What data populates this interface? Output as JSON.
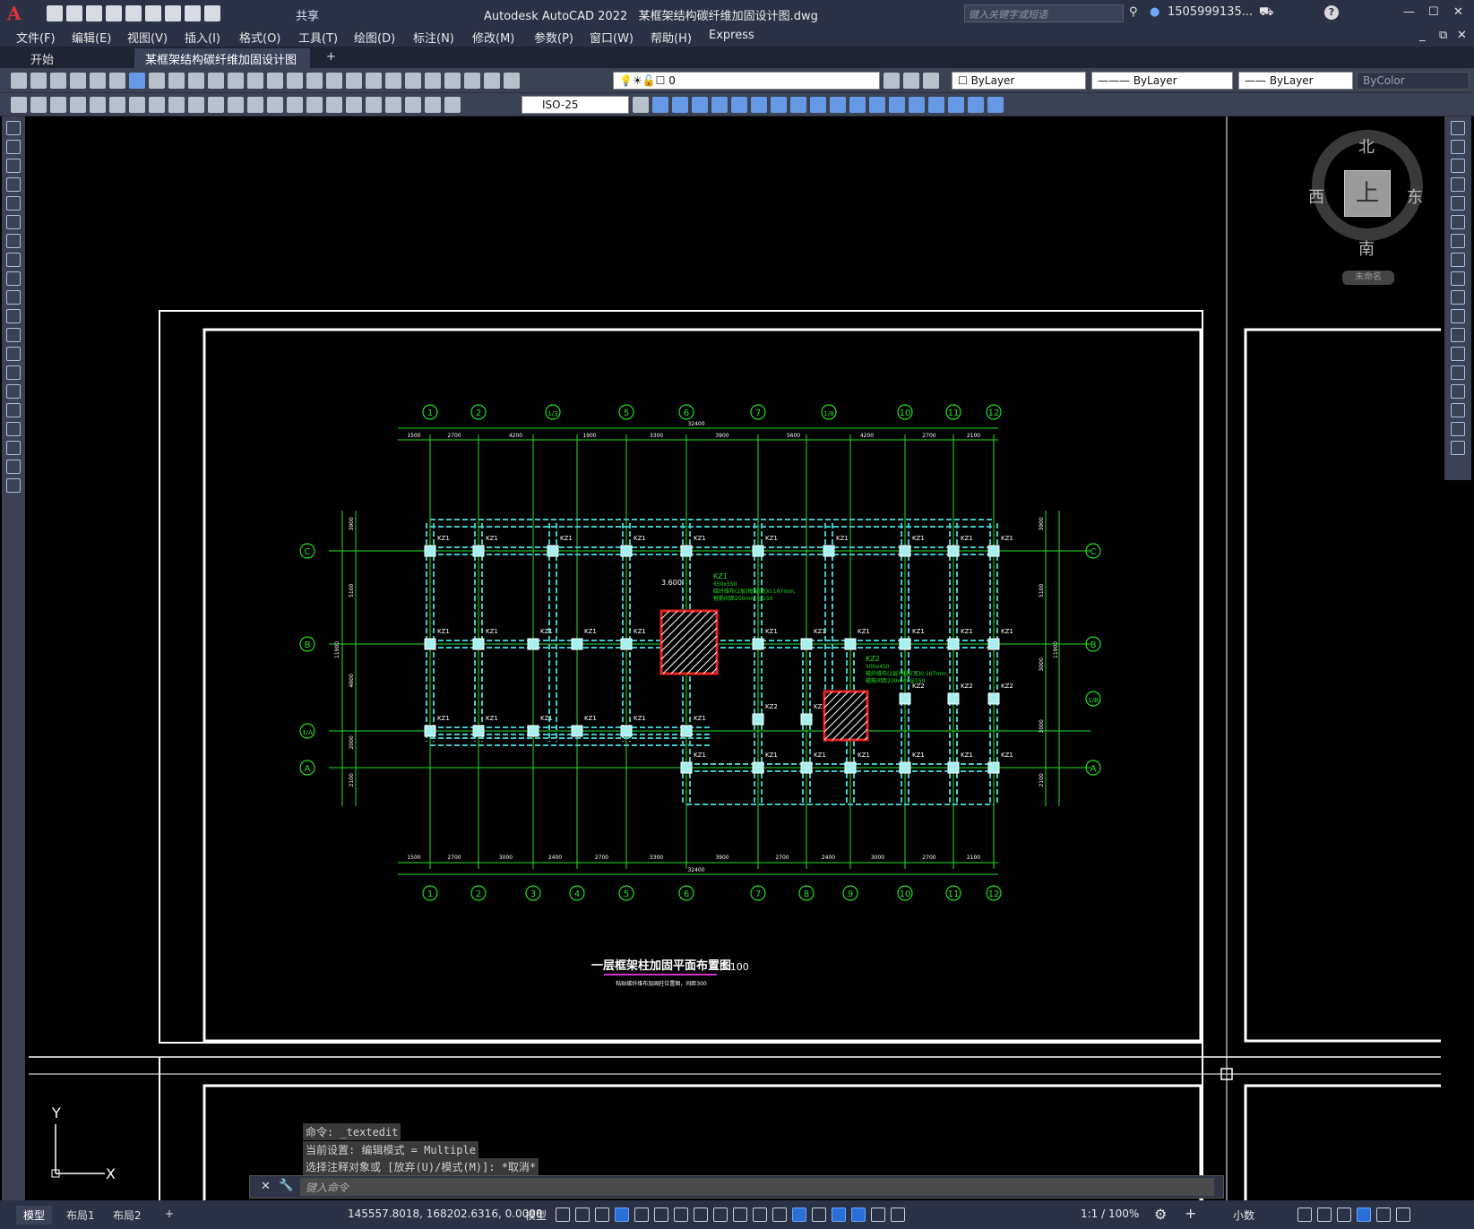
{
  "app": {
    "title": "Autodesk AutoCAD 2022",
    "filename": "某框架结构碳纤维加固设计图.dwg",
    "share_label": "共享",
    "search_placeholder": "键入关键字或短语",
    "user": "1505999135...",
    "help": "?"
  },
  "menu": [
    "文件(F)",
    "编辑(E)",
    "视图(V)",
    "插入(I)",
    "格式(O)",
    "工具(T)",
    "绘图(D)",
    "标注(N)",
    "修改(M)",
    "参数(P)",
    "窗口(W)",
    "帮助(H)",
    "Express"
  ],
  "tabs": {
    "start": "开始",
    "doc": "某框架结构碳纤维加固设计图*",
    "close": "✕",
    "add": "+"
  },
  "toolbar": {
    "layer_value": "0",
    "dimstyle": "ISO-25",
    "color": "ByLayer",
    "linetype": "ByLayer",
    "lineweight": "ByLayer",
    "plotstyle": "ByColor"
  },
  "viewcube": {
    "north": "北",
    "south": "南",
    "east": "东",
    "west": "西",
    "top": "上",
    "wcs": "未命名"
  },
  "drawing": {
    "axis_top": [
      "1",
      "2",
      "1/3",
      "5",
      "6",
      "7",
      "1/8",
      "10",
      "11",
      "12"
    ],
    "axis_bottom": [
      "1",
      "2",
      "3",
      "4",
      "5",
      "6",
      "7",
      "8",
      "9",
      "10",
      "11",
      "12"
    ],
    "axis_left": [
      "C",
      "B",
      "1/A",
      "A"
    ],
    "axis_right": [
      "C",
      "B",
      "1/B",
      "A"
    ],
    "dim_top": [
      "1500",
      "2700",
      "4200",
      "1900",
      "3300",
      "3900",
      "5600",
      "4200",
      "2700",
      "2100"
    ],
    "dim_top_total": "32400",
    "dim_bottom": [
      "1500",
      "2700",
      "3000",
      "2400",
      "2700",
      "3300",
      "3900",
      "2700",
      "2400",
      "3000",
      "2700",
      "2100"
    ],
    "dim_bottom_total": "32400",
    "dim_left": [
      "3900",
      "5100",
      "4800",
      "2000",
      "2100"
    ],
    "dim_left_total": "11900",
    "dim_right": [
      "3900",
      "5100",
      "3000",
      "3000",
      "2100"
    ],
    "dim_right_total": "11900",
    "col_label": "KZ1",
    "col_label2": "KZ2",
    "elev": "3.600",
    "note1": [
      "KZ1",
      "650x550",
      "碳纤维布(2层)每层(宽)0.167mm,",
      "箍筋间距200mm,@150"
    ],
    "note2": [
      "KZ2",
      "500x450",
      "碳纤维布(2层)每层(宽)0.167mm,",
      "箍筋间距200mm,@150"
    ],
    "title": "一层框架柱加固平面布置图",
    "scale": "1:100",
    "subtitle": "粘贴碳纤维布加固柱位置图，间距300"
  },
  "command": {
    "history": [
      "命令: _textedit",
      "当前设置: 编辑模式 = Multiple",
      "选择注释对象或 [放弃(U)/模式(M)]: *取消*"
    ],
    "placeholder": "键入命令"
  },
  "status": {
    "layouts": [
      "模型",
      "布局1",
      "布局2"
    ],
    "add": "+",
    "coords": "145557.8018, 168202.6316, 0.0000",
    "model": "模型",
    "scale": "1:1 / 100%",
    "units": "小数"
  }
}
